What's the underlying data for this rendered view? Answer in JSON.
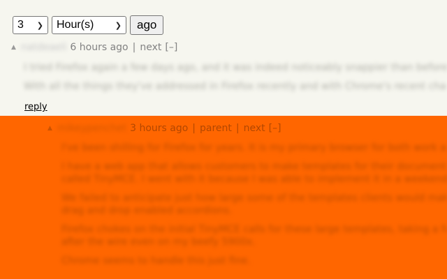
{
  "controls": {
    "count_value": "3",
    "unit_value": "Hour(s)",
    "submit_label": "ago"
  },
  "comment1": {
    "username": "natdeaeli",
    "age": "6 hours ago",
    "sep": "|",
    "next_label": "next",
    "toggle_label": "[–]",
    "paragraphs": [
      "I tried Firefox again a few days ago, and it was indeed noticeably snappier than before.",
      "With all the things they've addressed in Firefox recently and with Chrome's recent changes, I may switch back."
    ],
    "reply_label": "reply"
  },
  "comment2": {
    "username": "mikeypenchet",
    "age": "3 hours ago",
    "sep": "|",
    "parent_label": "parent",
    "next_label": "next",
    "toggle_label": "[–]",
    "paragraphs": [
      "I've been shilling for Firefox for years. It is my primary browser for both work and home.",
      "I have a web app that allows customers to make templates for their documents using an editor",
      "called TinyMCE. I went with it because I was able to implement it in a weekend.",
      "We failed to anticipate just how large some of the templates clients would make, with lots of",
      "drag and drop enabled accordions.",
      "Firefox chokes on the initial TinyMCE calls for these large templates, taking a few seconds",
      "after the wire even on my beefy 5900x.",
      "Chrome seems to handle this just fine."
    ]
  },
  "colors": {
    "page_bg": "#f6f6ef",
    "highlight_bg": "#ff6600",
    "meta_text": "#828282"
  }
}
